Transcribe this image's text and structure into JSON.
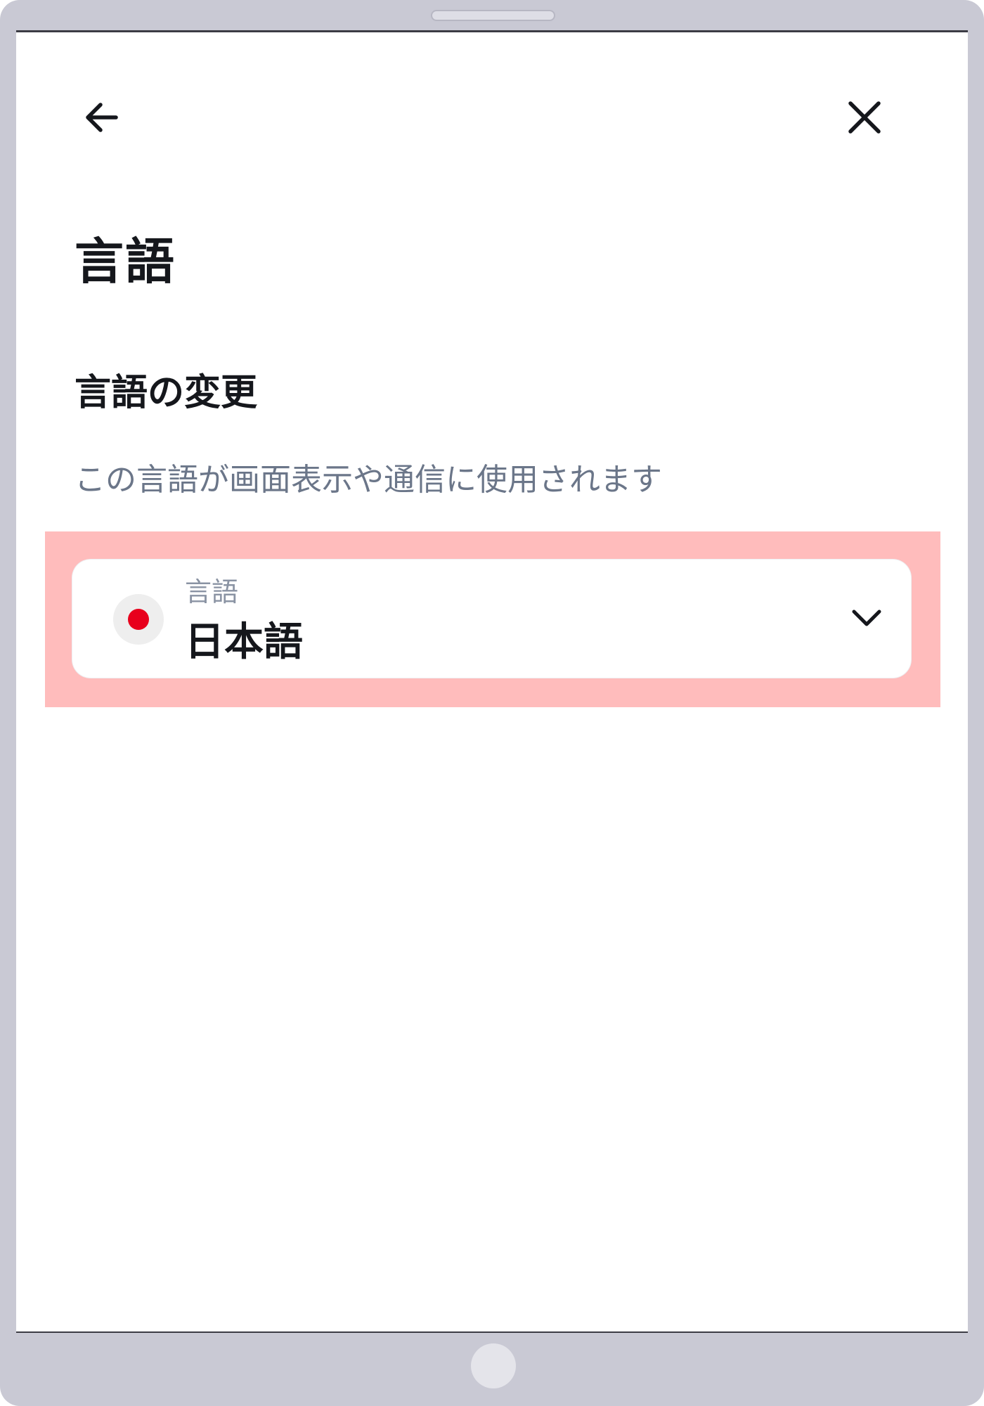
{
  "header": {
    "back_icon": "arrow-left-icon",
    "close_icon": "close-icon"
  },
  "page": {
    "title": "言語",
    "section_title": "言語の変更",
    "description": "この言語が画面表示や通信に使用されます"
  },
  "language_select": {
    "label": "言語",
    "value": "日本語",
    "flag_icon": "japan-flag-icon",
    "chevron_icon": "chevron-down-icon",
    "flag_color": "#e8001c"
  },
  "colors": {
    "highlight": "#ffbcbc",
    "device_frame": "#c9c9d4",
    "text_primary": "#15171c",
    "text_secondary": "#6b7689"
  }
}
